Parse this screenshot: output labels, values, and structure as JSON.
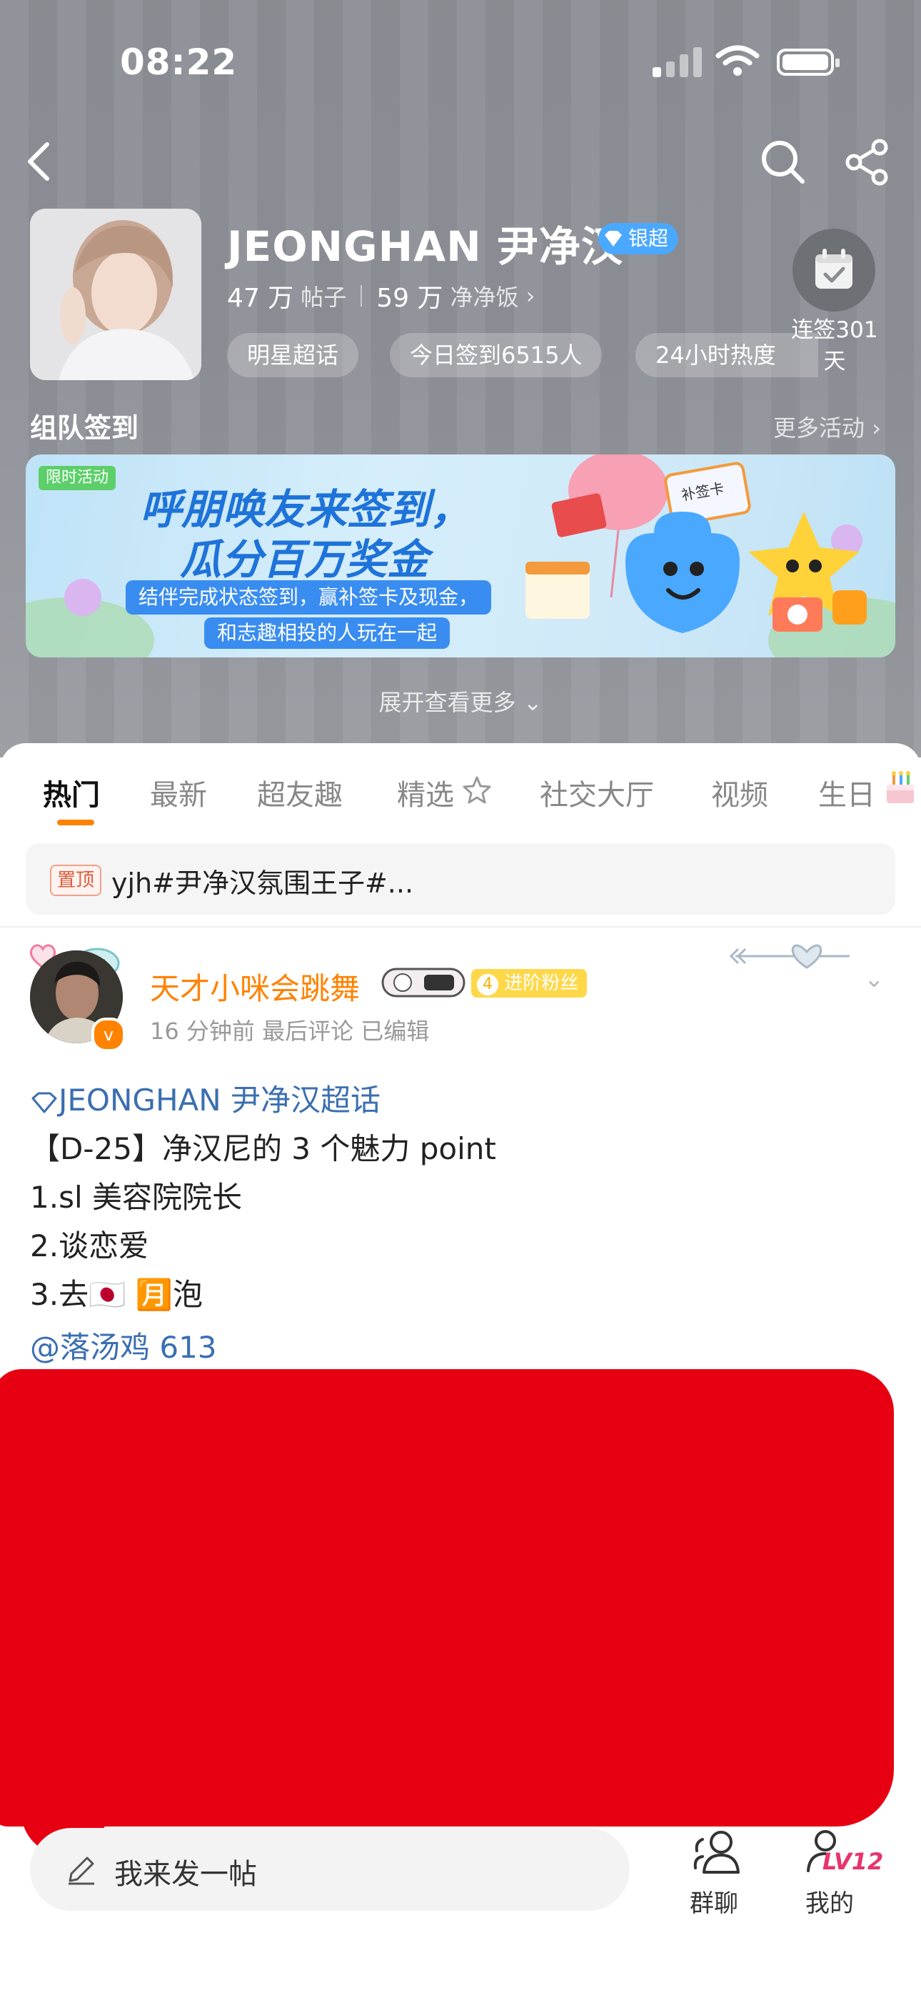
{
  "status_bar": {
    "time": "08:22"
  },
  "topic": {
    "name": "JEONGHAN 尹净汉",
    "tier_badge": "银超",
    "posts_count": "47 万",
    "posts_label": "帖子",
    "fans_count": "59 万",
    "fans_label": "净净饭",
    "chips": [
      "明星超话",
      "今日签到6515人",
      "24小时热度"
    ],
    "checkin_label": "连签301天"
  },
  "activity": {
    "title": "组队签到",
    "more": "更多活动",
    "banner": {
      "tag": "限时活动",
      "headline_line1": "呼朋唤友来签到，",
      "headline_line2": "瓜分百万奖金",
      "sub_line1": "结伴完成状态签到，赢补签卡及现金，",
      "sub_line2": "和志趣相投的人玩在一起",
      "card_label": "补签卡"
    },
    "expand": "展开查看更多"
  },
  "tabs": [
    "热门",
    "最新",
    "超友趣",
    "精选",
    "社交大厅",
    "视频",
    "生日"
  ],
  "active_tab": 0,
  "pinned": {
    "tag": "置顶",
    "text": "yjh#尹净汉氛围王子#..."
  },
  "post": {
    "username": "天才小咪会跳舞",
    "fan_badge_level": "4",
    "fan_badge_text": "进阶粉丝",
    "meta": "16 分钟前 最后评论    已编辑",
    "topic_link": "JEONGHAN 尹净汉超话",
    "lines": [
      "【D-25】净汉尼的 3 个魅力 point",
      "1.sl 美容院院长",
      "2.谈恋爱",
      "3.去🇯🇵 🈷️泡"
    ],
    "mention": "@落汤鸡 613"
  },
  "bottom_bar": {
    "composer_placeholder": "我来发一帖",
    "group_chat": "群聊",
    "mine": "我的",
    "level": "LV12"
  },
  "colors": {
    "accent": "#ff8200",
    "link": "#3b6fb0",
    "redaction": "#e60012",
    "tier_badge": "#4aa8ff"
  }
}
